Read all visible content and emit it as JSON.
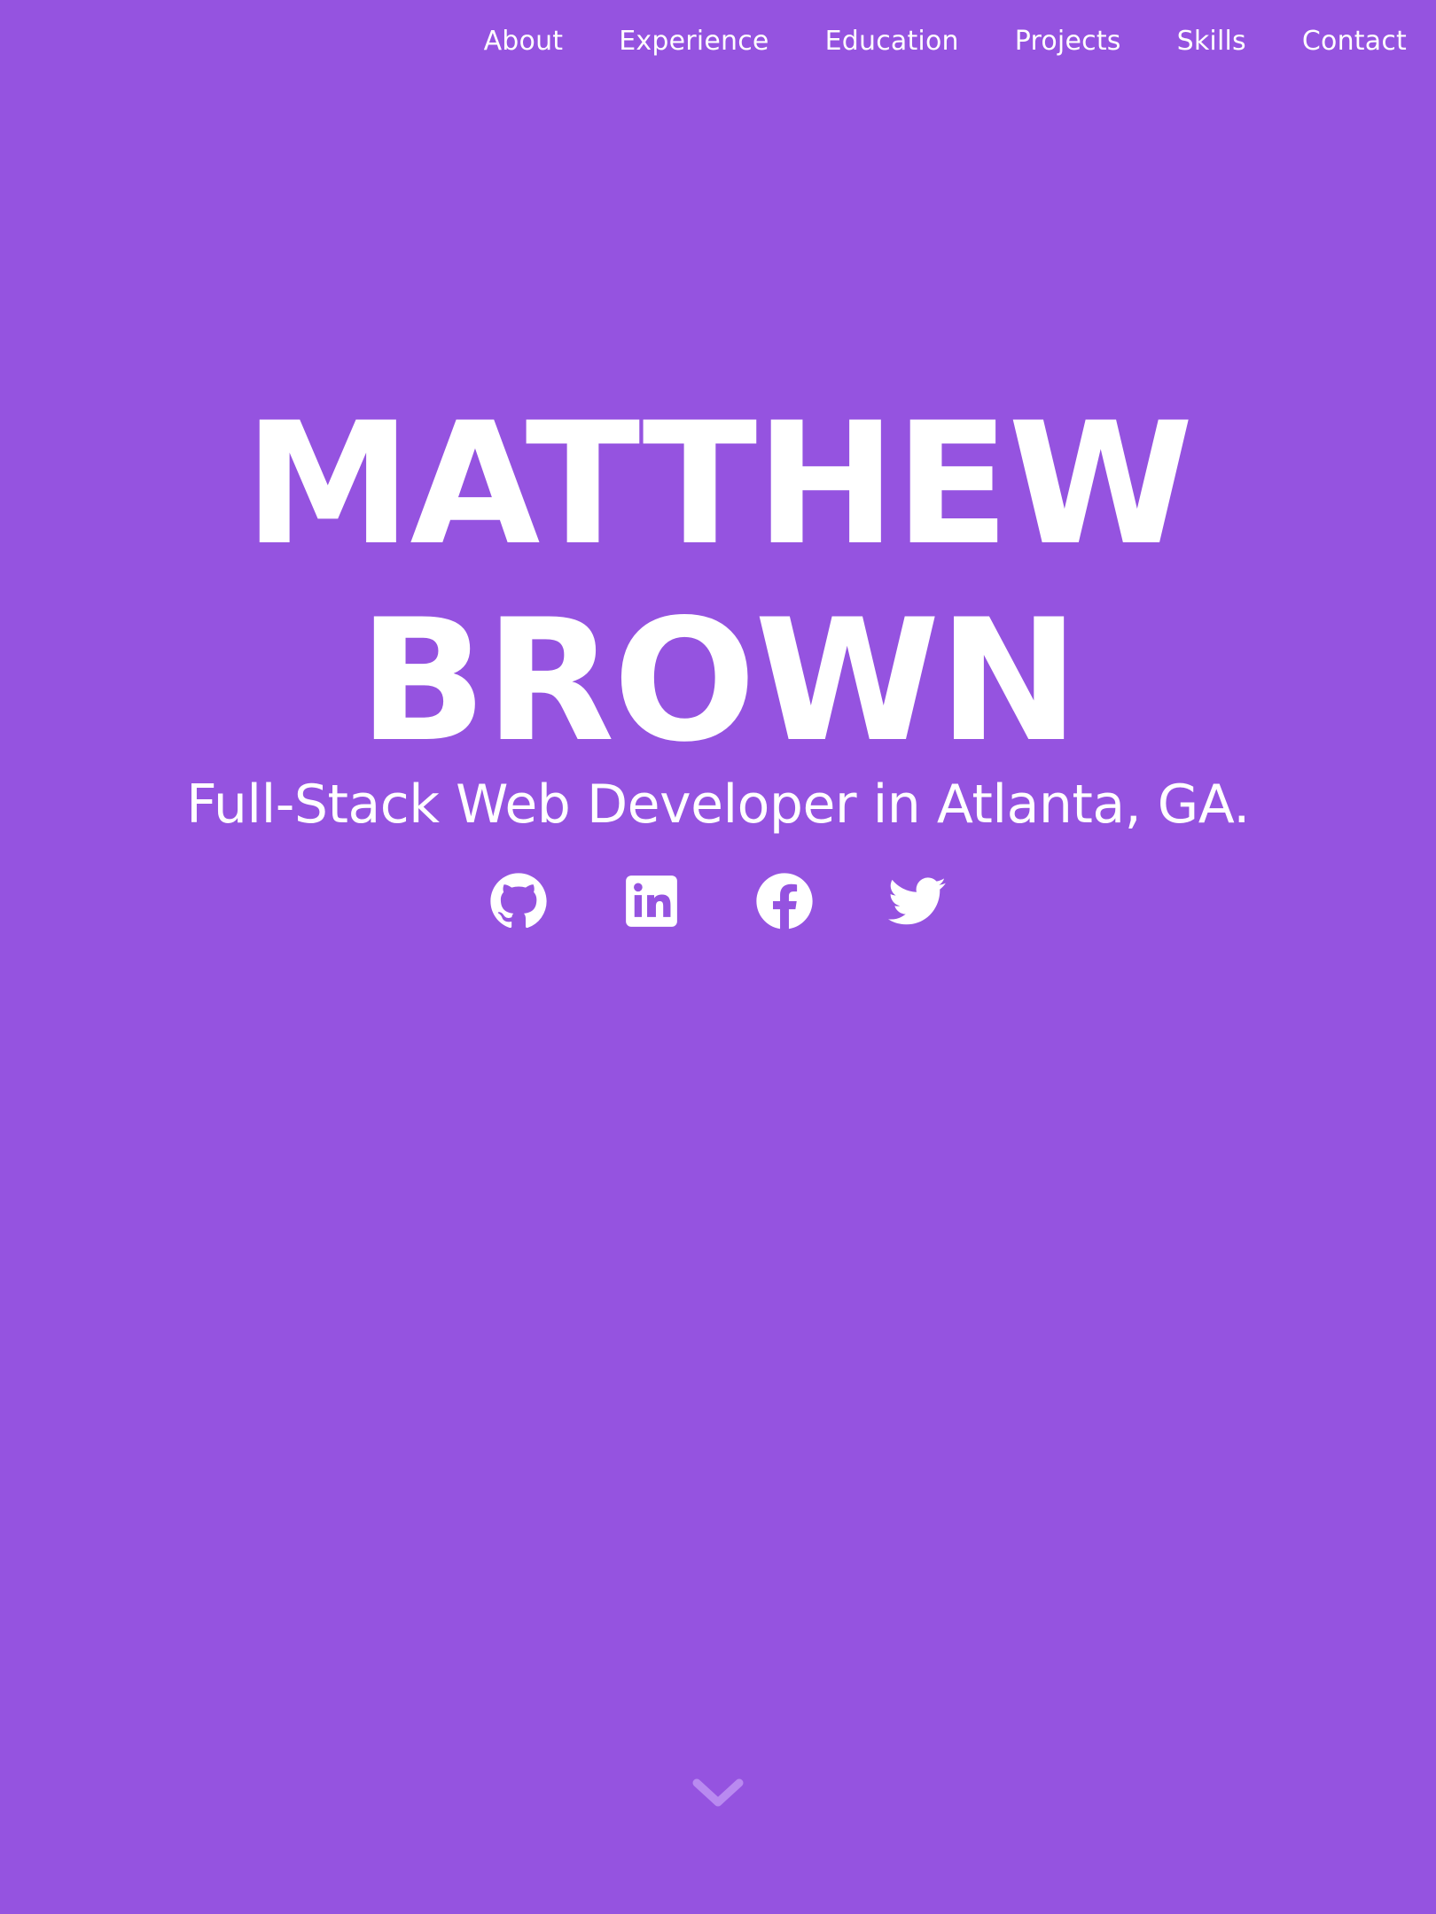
{
  "nav": {
    "items": [
      {
        "label": "About"
      },
      {
        "label": "Experience"
      },
      {
        "label": "Education"
      },
      {
        "label": "Projects"
      },
      {
        "label": "Skills"
      },
      {
        "label": "Contact"
      }
    ]
  },
  "hero": {
    "name_line_1": "MATTHEW",
    "name_line_2": "BROWN",
    "subtitle": "Full-Stack Web Developer in Atlanta, GA."
  },
  "socials": {
    "icons": [
      "github-icon",
      "linkedin-icon",
      "facebook-icon",
      "twitter-icon"
    ]
  },
  "scroll": {
    "icon": "chevron-down-icon"
  },
  "colors": {
    "background": "#9553e0",
    "foreground": "#ffffff",
    "scroll_arrow": "#b98af0"
  }
}
